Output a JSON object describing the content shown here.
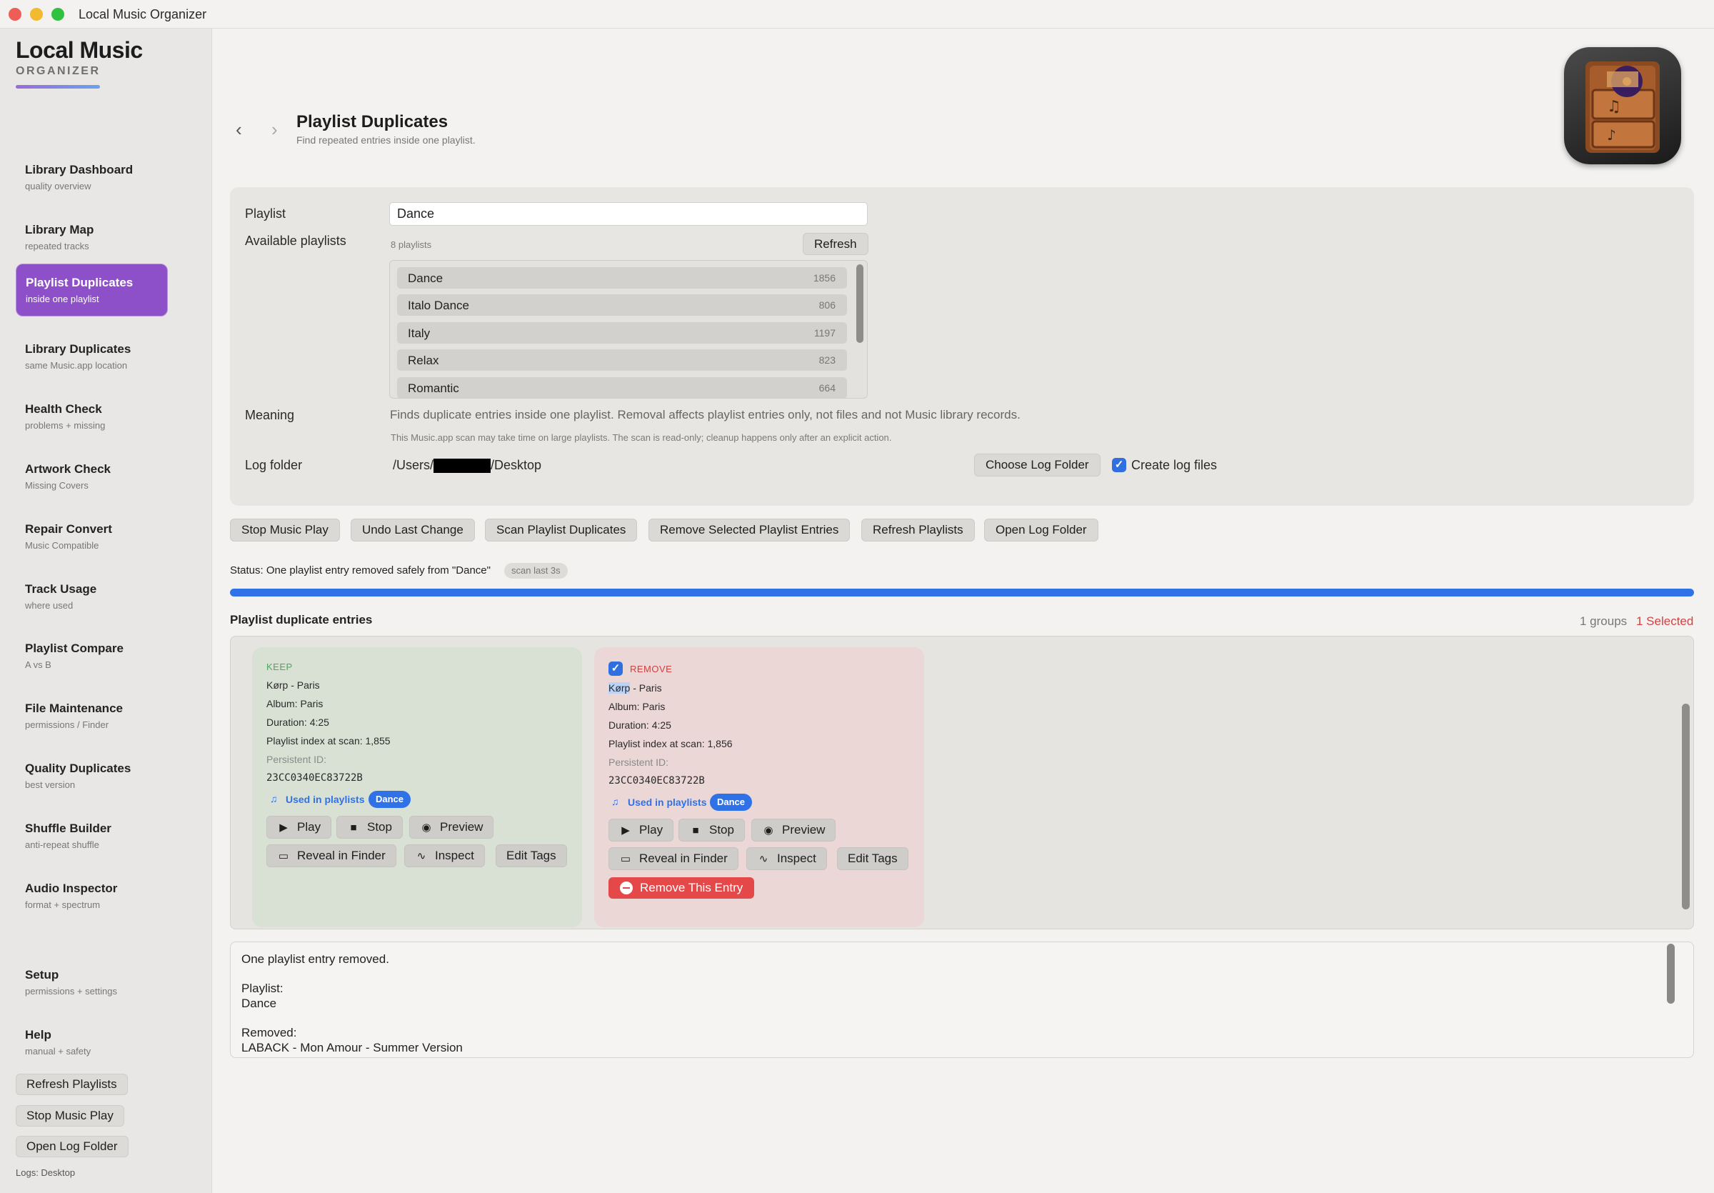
{
  "window": {
    "title": "Local Music Organizer"
  },
  "brand": {
    "title": "Local Music",
    "subtitle": "ORGANIZER"
  },
  "sidebar": {
    "items": [
      {
        "label": "Library Dashboard",
        "sub": "quality overview"
      },
      {
        "label": "Library Map",
        "sub": "repeated tracks"
      },
      {
        "label": "Playlist Duplicates",
        "sub": "inside one playlist"
      },
      {
        "label": "Library Duplicates",
        "sub": "same Music.app location"
      },
      {
        "label": "Health Check",
        "sub": "problems + missing"
      },
      {
        "label": "Artwork Check",
        "sub": "Missing Covers"
      },
      {
        "label": "Repair Convert",
        "sub": "Music Compatible"
      },
      {
        "label": "Track Usage",
        "sub": "where used"
      },
      {
        "label": "Playlist Compare",
        "sub": "A vs B"
      },
      {
        "label": "File Maintenance",
        "sub": "permissions / Finder"
      },
      {
        "label": "Quality Duplicates",
        "sub": "best version"
      },
      {
        "label": "Shuffle Builder",
        "sub": "anti-repeat shuffle"
      },
      {
        "label": "Audio Inspector",
        "sub": "format + spectrum"
      },
      {
        "label": "Setup",
        "sub": "permissions + settings"
      },
      {
        "label": "Help",
        "sub": "manual + safety"
      }
    ],
    "buttons": {
      "refresh": "Refresh Playlists",
      "stop": "Stop Music Play",
      "open_log": "Open Log Folder"
    },
    "logs_label": "Logs: Desktop"
  },
  "header": {
    "back": "‹",
    "forward": "›",
    "title": "Playlist Duplicates",
    "subtitle": "Find repeated entries inside one playlist."
  },
  "form": {
    "playlist_label": "Playlist",
    "playlist_value": "Dance",
    "available_label": "Available playlists",
    "count_text": "8 playlists",
    "refresh_label": "Refresh",
    "playlists": [
      {
        "name": "Dance",
        "count": "1856"
      },
      {
        "name": "Italo Dance",
        "count": "806"
      },
      {
        "name": "Italy",
        "count": "1197"
      },
      {
        "name": "Relax",
        "count": "823"
      },
      {
        "name": "Romantic",
        "count": "664"
      }
    ],
    "meaning_label": "Meaning",
    "meaning_text": "Finds duplicate entries inside one playlist. Removal affects playlist entries only, not files and not Music library records.",
    "note_text": "This Music.app scan may take time on large playlists. The scan is read-only; cleanup happens only after an explicit action.",
    "log_label": "Log folder",
    "log_path_prefix": "/Users/",
    "log_path_suffix": "/Desktop",
    "choose_log": "Choose Log Folder",
    "create_log": "Create log files"
  },
  "actions": {
    "stop_play": "Stop Music Play",
    "undo": "Undo Last Change",
    "scan": "Scan Playlist Duplicates",
    "remove_selected": "Remove Selected Playlist Entries",
    "refresh": "Refresh Playlists",
    "open_log": "Open Log Folder"
  },
  "status": {
    "text": "Status: One playlist entry removed safely from \"Dance\"",
    "badge": "scan last 3s",
    "progress": 1.0
  },
  "results": {
    "title": "Playlist duplicate entries",
    "groups": "1 groups",
    "selected": "1 Selected",
    "keep": {
      "tag": "KEEP",
      "title": "Kørp - Paris",
      "album": "Album: Paris",
      "duration": "Duration: 4:25",
      "index": "Playlist index at scan: 1,855",
      "pid_label": "Persistent ID:",
      "pid": "23CC0340EC83722B",
      "used": "Used in playlists",
      "playlist": "Dance"
    },
    "remove": {
      "tag": "REMOVE",
      "title_hl": "Kørp",
      "title_rest": " - Paris",
      "album": "Album: Paris",
      "duration": "Duration: 4:25",
      "index": "Playlist index at scan: 1,856",
      "pid_label": "Persistent ID:",
      "pid": "23CC0340EC83722B",
      "used": "Used in playlists",
      "playlist": "Dance",
      "remove_label": "Remove This Entry"
    },
    "buttons": {
      "play": "Play",
      "stop": "Stop",
      "preview": "Preview",
      "reveal": "Reveal in Finder",
      "inspect": "Inspect",
      "edit": "Edit Tags"
    }
  },
  "log": {
    "line1": "One playlist entry removed.",
    "line2": "Playlist:",
    "line3": "Dance",
    "line4": "Removed:",
    "line5": "LABACK - Mon Amour - Summer Version"
  },
  "colors": {
    "accent": "#8e50c8",
    "progress": "#2f72e8",
    "danger": "#e54848",
    "selected": "#d74040"
  }
}
